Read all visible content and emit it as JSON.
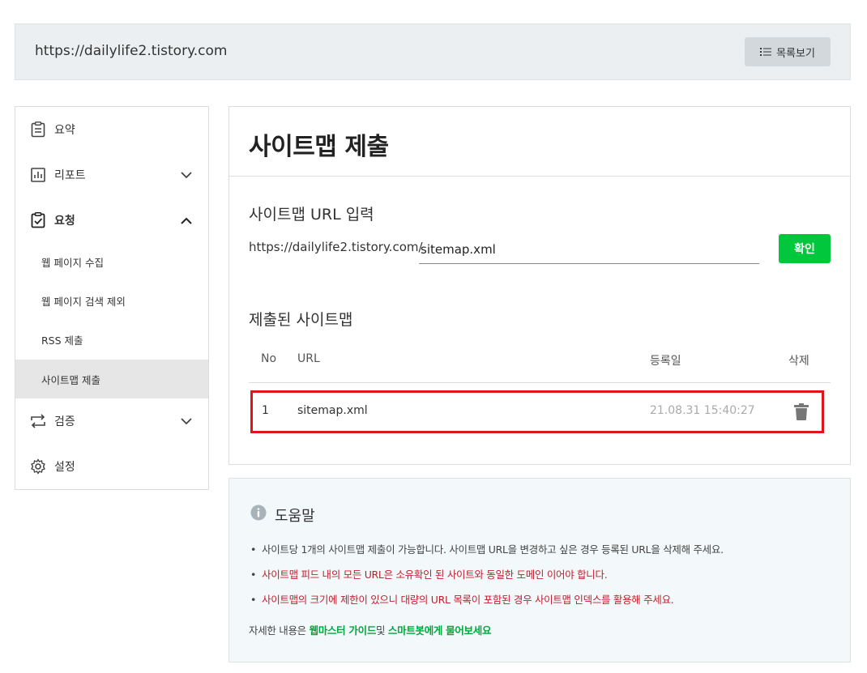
{
  "header": {
    "site_url": "https://dailylife2.tistory.com",
    "list_button": "목록보기"
  },
  "sidebar": {
    "items": [
      {
        "label": "요약",
        "icon": "clipboard-icon"
      },
      {
        "label": "리포트",
        "icon": "bar-chart-icon"
      },
      {
        "label": "요청",
        "icon": "clipboard-check-icon"
      },
      {
        "label": "검증",
        "icon": "repeat-icon"
      },
      {
        "label": "설정",
        "icon": "gear-icon"
      }
    ],
    "sub_items": [
      {
        "label": "웹 페이지 수집"
      },
      {
        "label": "웹 페이지 검색 제외"
      },
      {
        "label": "RSS 제출"
      },
      {
        "label": "사이트맵 제출"
      }
    ]
  },
  "main": {
    "title": "사이트맵 제출",
    "input_section_title": "사이트맵 URL 입력",
    "url_prefix": "https://dailylife2.tistory.com/",
    "url_value": "sitemap.xml",
    "confirm_button": "확인",
    "submitted_section_title": "제출된 사이트맵",
    "table": {
      "headers": {
        "no": "No",
        "url": "URL",
        "date": "등록일",
        "delete": "삭제"
      },
      "rows": [
        {
          "no": "1",
          "url": "sitemap.xml",
          "date": "21.08.31 15:40:27"
        }
      ]
    }
  },
  "help": {
    "title": "도움말",
    "items": [
      "사이트당 1개의 사이트맵 제출이 가능합니다. 사이트맵 URL을 변경하고 싶은 경우 등록된 URL을 삭제해 주세요.",
      "사이트맵 피드 내의 모든 URL은 소유확인 된 사이트와 동일한 도메인 이어야 합니다.",
      "사이트맵의 크기에 제한이 있으니 대량의 URL 목록이 포함된 경우 사이트맵 인덱스를 활용해 주세요."
    ],
    "footer_prefix": "자세한 내용은 ",
    "footer_link1": "웹마스터 가이드",
    "footer_mid": "및 ",
    "footer_link2": "스마트봇에게 물어보세요"
  },
  "colors": {
    "accent_green": "#00c73c",
    "highlight_red": "#e0151b",
    "warning_red": "#c0202e"
  }
}
